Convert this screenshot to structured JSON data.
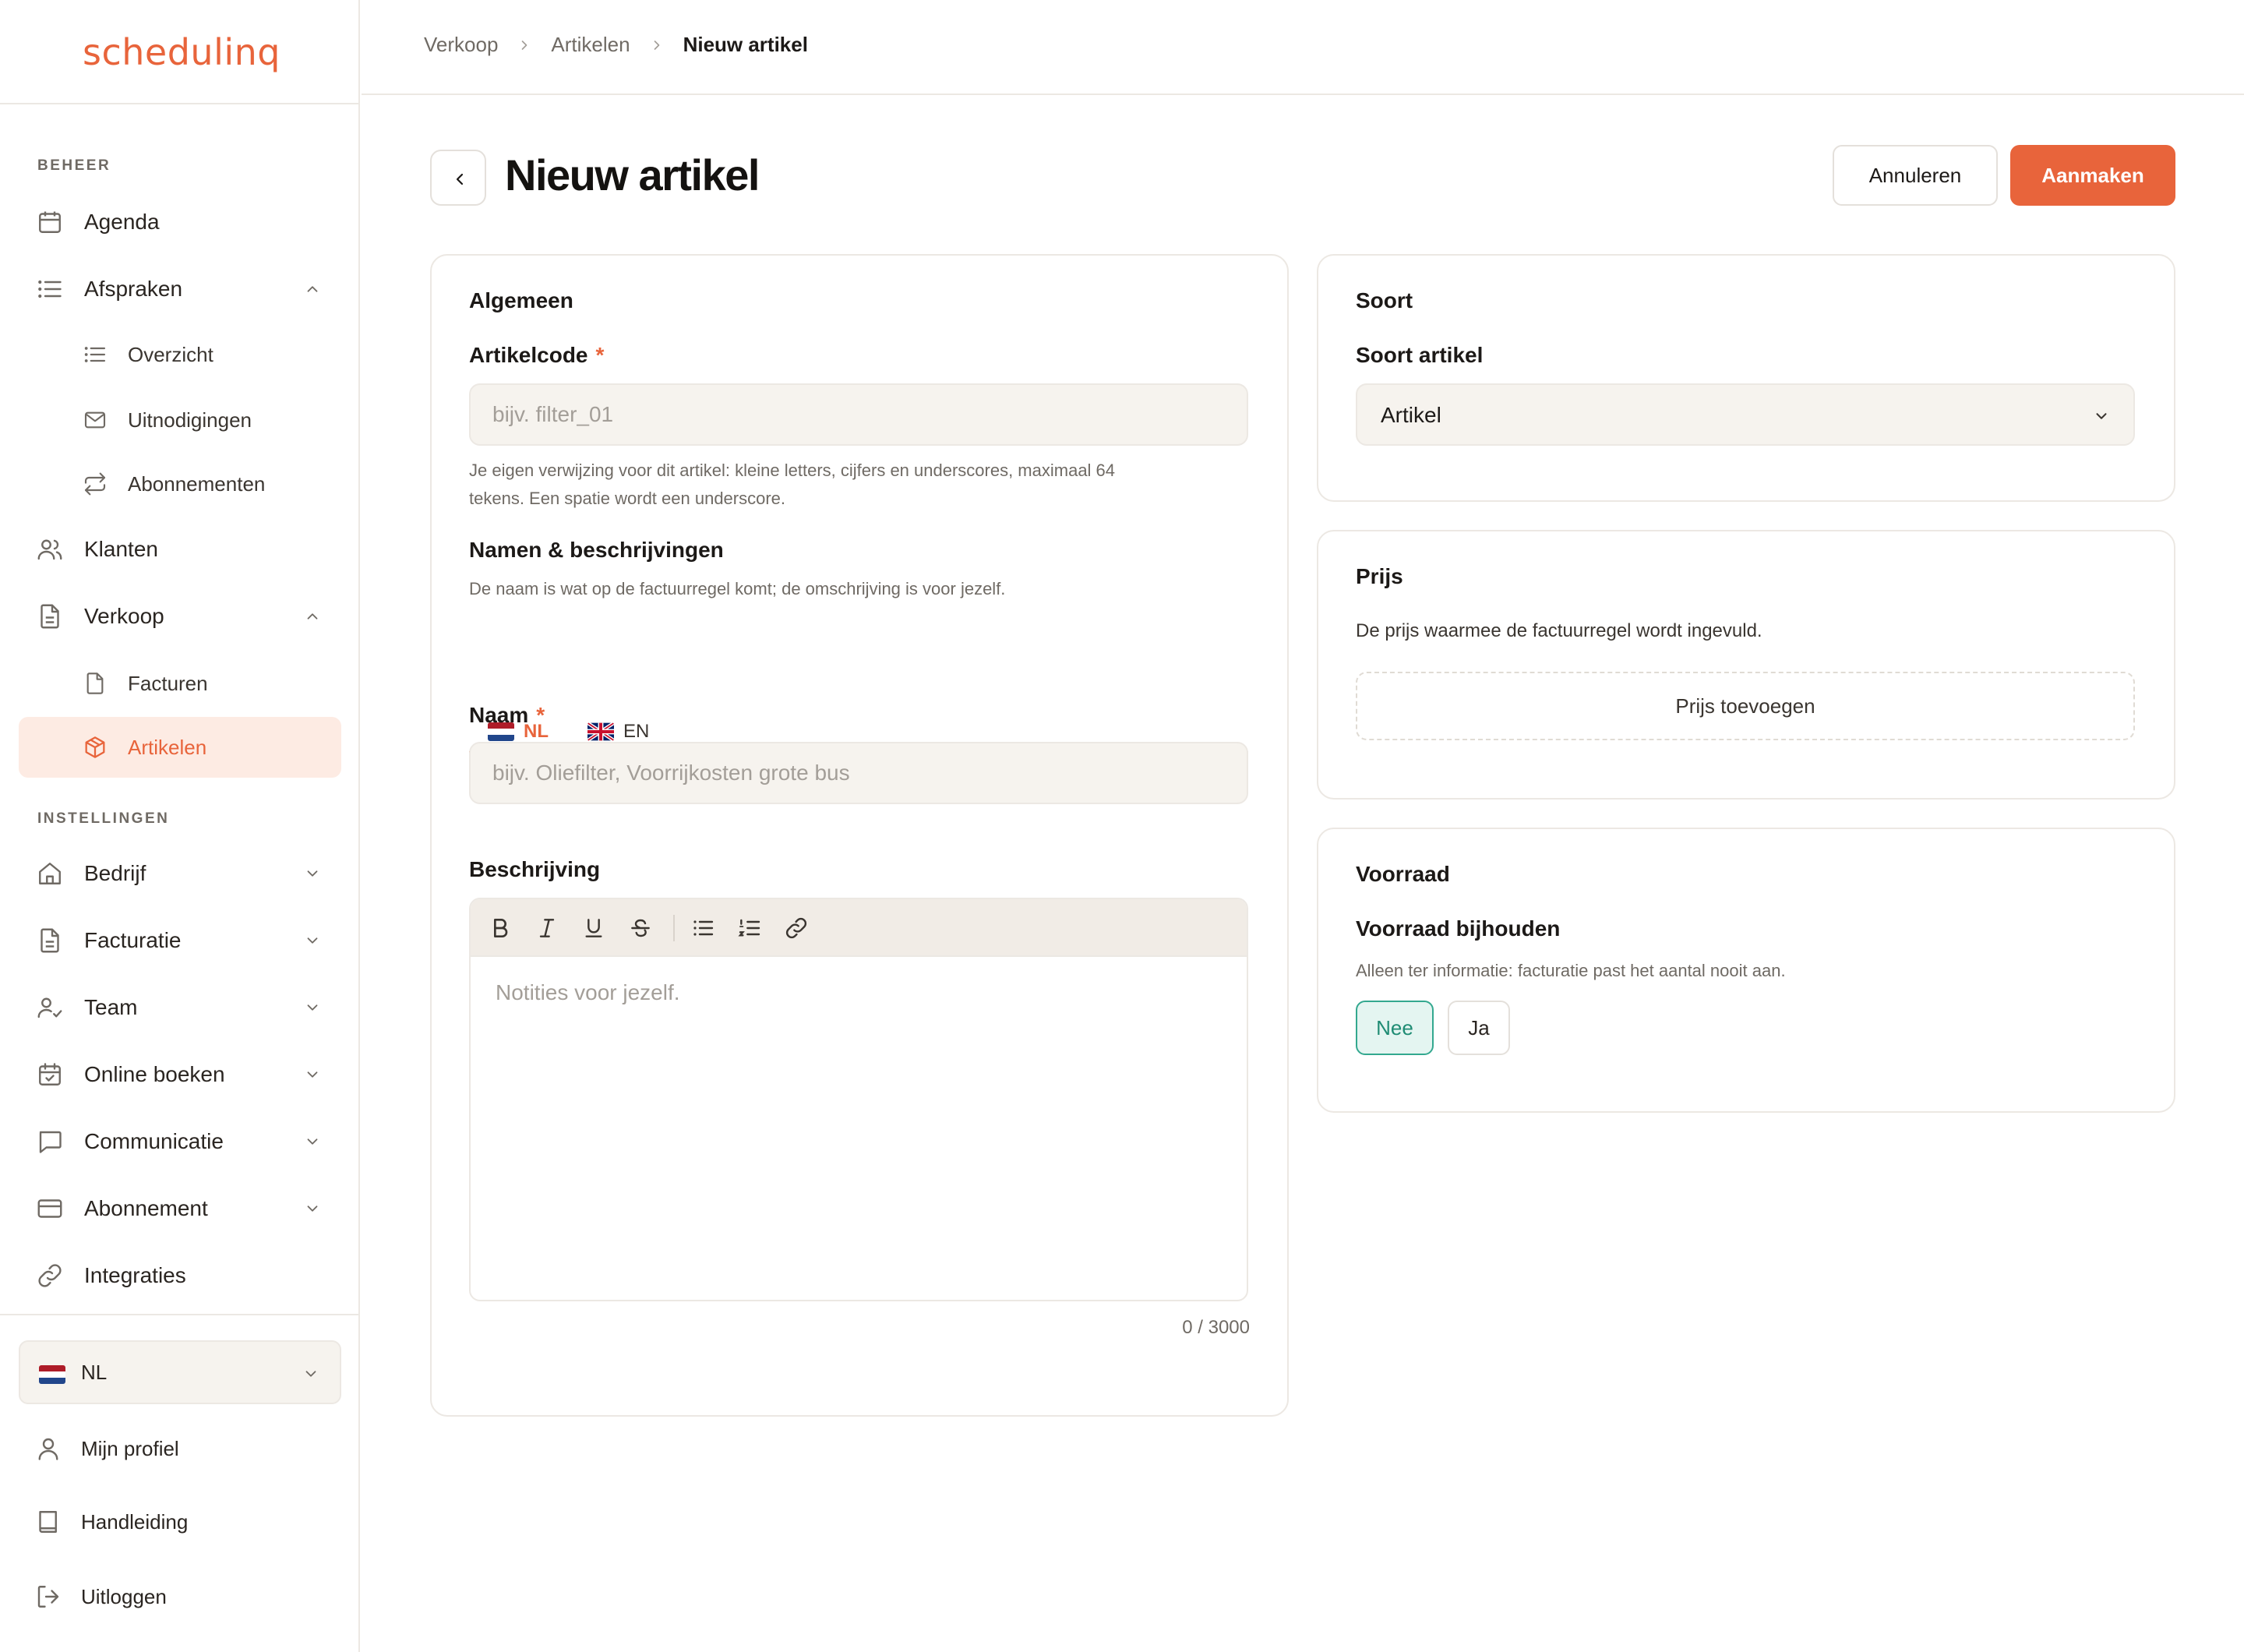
{
  "app": {
    "logo": "schedulinq"
  },
  "sidebar": {
    "section_manage": "BEHEER",
    "section_settings": "INSTELLINGEN",
    "agenda": "Agenda",
    "appointments": "Afspraken",
    "appointments_sub": {
      "overview": "Overzicht",
      "invitations": "Uitnodigingen",
      "subscriptions": "Abonnementen"
    },
    "customers": "Klanten",
    "sales": "Verkoop",
    "sales_sub": {
      "invoices": "Facturen",
      "articles": "Artikelen"
    },
    "company": "Bedrijf",
    "invoicing": "Facturatie",
    "team": "Team",
    "online_booking": "Online boeken",
    "communication": "Communicatie",
    "subscription": "Abonnement",
    "integrations": "Integraties",
    "language": "NL",
    "profile": "Mijn profiel",
    "manual": "Handleiding",
    "logout": "Uitloggen"
  },
  "breadcrumb": {
    "items": [
      "Verkoop",
      "Artikelen",
      "Nieuw artikel"
    ]
  },
  "header": {
    "title": "Nieuw artikel",
    "cancel": "Annuleren",
    "create": "Aanmaken"
  },
  "general": {
    "title": "Algemeen",
    "code_label": "Artikelcode",
    "required_mark": "*",
    "code_placeholder": "bijv. filter_01",
    "code_help_1": "Je eigen verwijzing voor dit artikel: kleine letters, cijfers en underscores, maximaal 64",
    "code_help_2": "tekens. Een spatie wordt een underscore.",
    "names_title": "Namen & beschrijvingen",
    "names_help": "De naam is wat op de factuurregel komt; de omschrijving is voor jezelf.",
    "tab_nl": "NL",
    "tab_en": "EN",
    "name_label": "Naam",
    "name_placeholder": "bijv. Oliefilter, Voorrijkosten grote bus",
    "desc_label": "Beschrijving",
    "desc_placeholder": "Notities voor jezelf.",
    "char_count": "0 / 3000"
  },
  "type": {
    "title": "Soort",
    "label": "Soort artikel",
    "value": "Artikel"
  },
  "price": {
    "title": "Prijs",
    "help": "De prijs waarmee de factuurregel wordt ingevuld.",
    "add": "Prijs toevoegen"
  },
  "stock": {
    "title": "Voorraad",
    "label": "Voorraad bijhouden",
    "help": "Alleen ter informatie: facturatie past het aantal nooit aan.",
    "no": "Nee",
    "yes": "Ja",
    "selected": "Nee"
  },
  "colors": {
    "accent": "#e8643b",
    "active_bg": "#fdebe3",
    "toggle_selected": "#33a88f"
  }
}
